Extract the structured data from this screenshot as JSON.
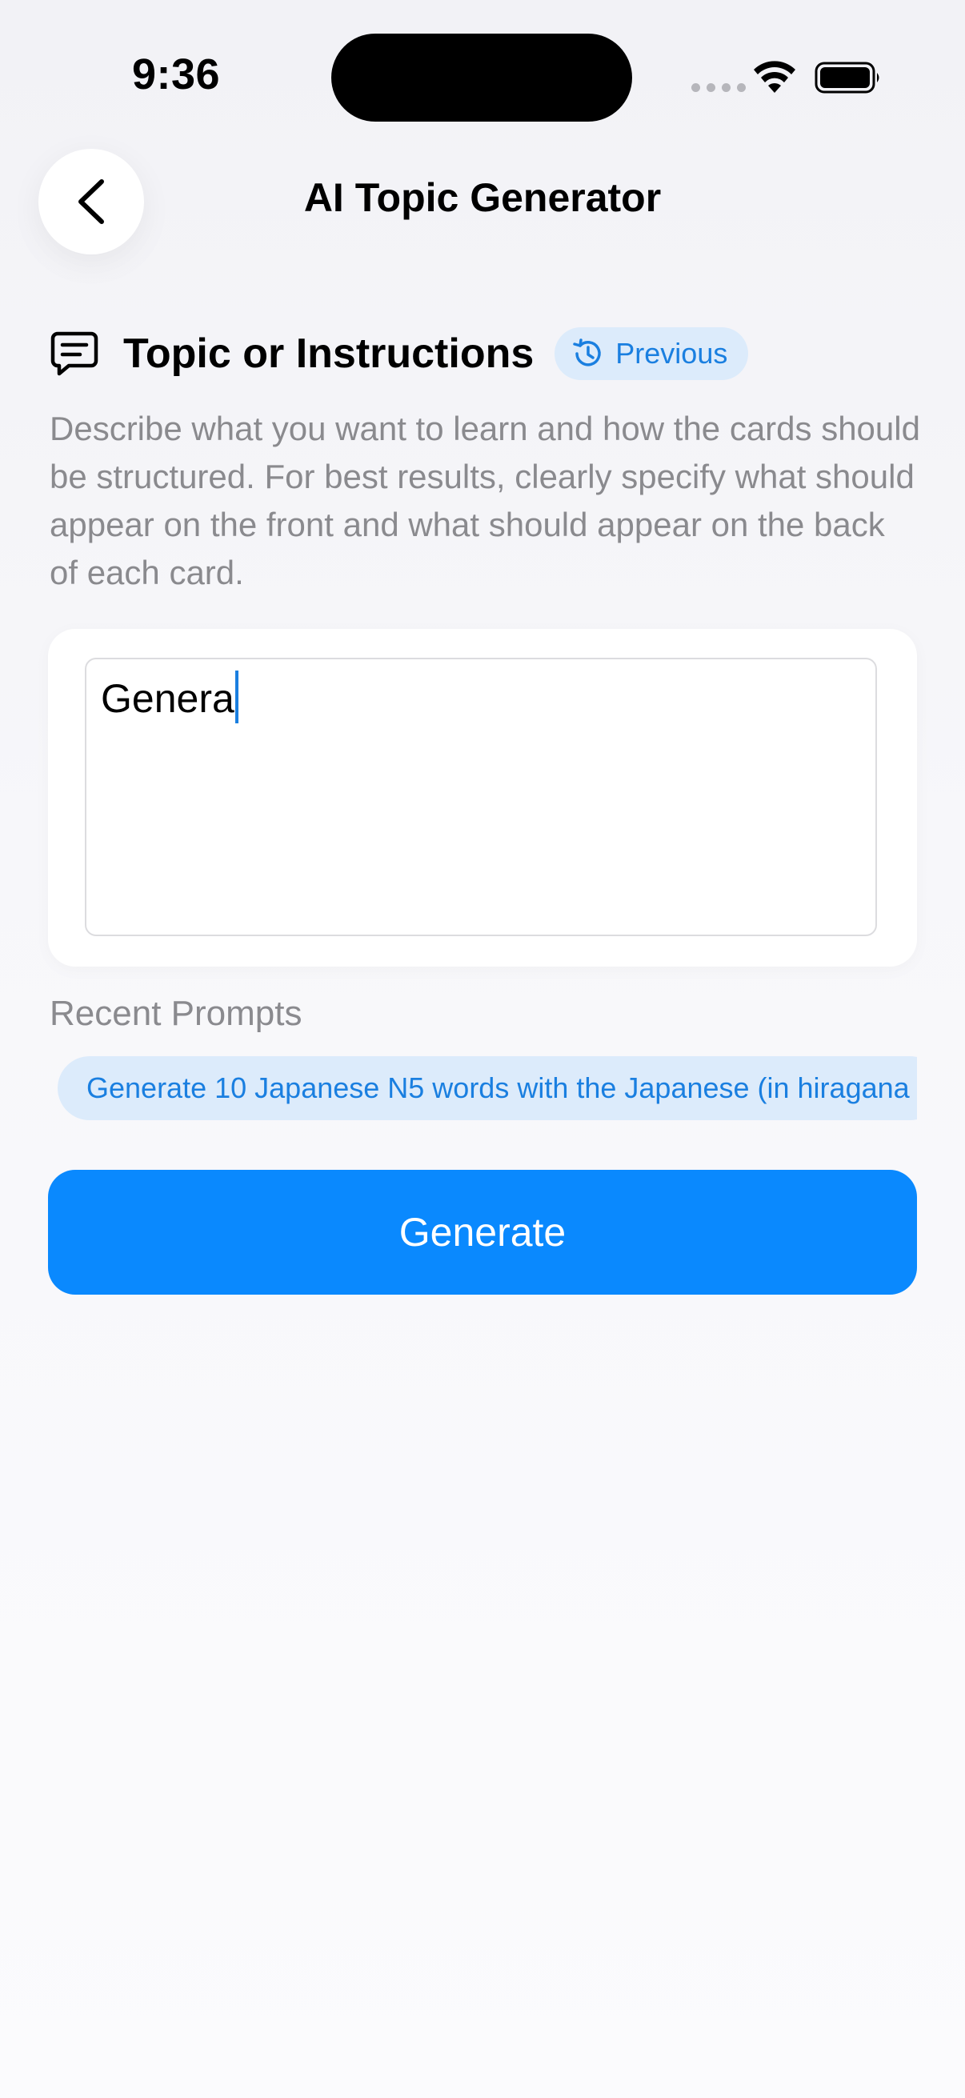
{
  "status_bar": {
    "time": "9:36"
  },
  "header": {
    "title": "AI Topic Generator",
    "back_icon": "chevron-left-icon"
  },
  "section": {
    "icon": "chat-bubble-icon",
    "title": "Topic or Instructions",
    "previous_label": "Previous",
    "previous_icon": "history-icon",
    "description": "Describe what you want to learn and how the cards should be structured. For best results, clearly specify what should appear on the front and what should appear on the back of each card."
  },
  "input": {
    "value": "Genera"
  },
  "recent": {
    "label": "Recent Prompts",
    "prompts": [
      "Generate 10 Japanese N5  words with the Japanese (in hiragana"
    ]
  },
  "actions": {
    "generate_label": "Generate"
  },
  "colors": {
    "accent": "#0a89fe",
    "chip_bg": "#dcebfb",
    "secondary_text": "#8a8a8e"
  }
}
